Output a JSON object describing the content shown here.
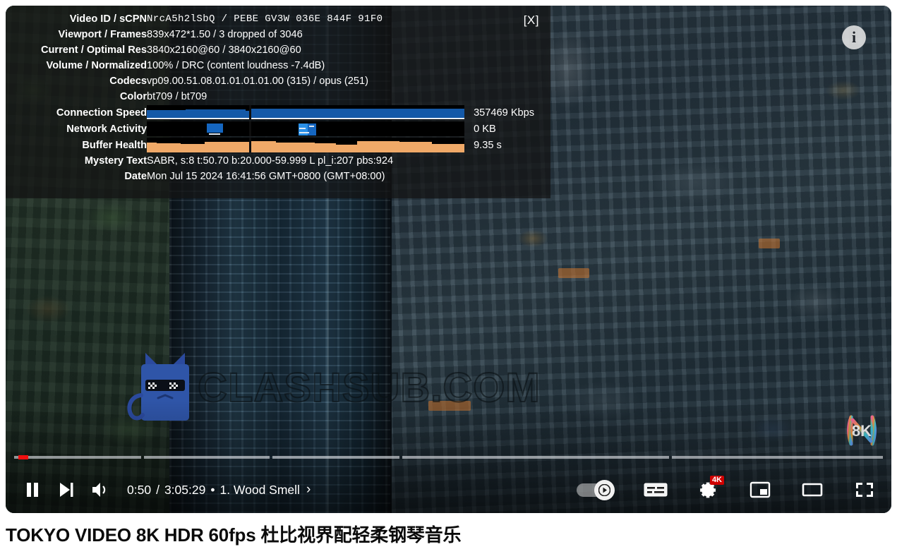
{
  "player": {
    "info_icon": "info-icon",
    "watermark_text": "CLASHSUB.COM",
    "quality_badge": "8K",
    "cat_logo": "cool-cat-logo"
  },
  "stats": {
    "close_label": "[X]",
    "rows": [
      {
        "key": "Video ID / sCPN",
        "value": "NrcA5h2lSbQ / PEBE GV3W 036E 844F 91F0",
        "mono": true
      },
      {
        "key": "Viewport / Frames",
        "value": "839x472*1.50 / 3 dropped of 3046",
        "mono": false
      },
      {
        "key": "Current / Optimal Res",
        "value": "3840x2160@60 / 3840x2160@60",
        "mono": false
      },
      {
        "key": "Volume / Normalized",
        "value": "100% / DRC (content loudness -7.4dB)",
        "mono": false
      },
      {
        "key": "Codecs",
        "value": "vp09.00.51.08.01.01.01.01.00 (315) / opus (251)",
        "mono": false
      },
      {
        "key": "Color",
        "value": "bt709 / bt709",
        "mono": false
      }
    ],
    "graphs": [
      {
        "key": "Connection Speed",
        "value": "357469 Kbps"
      },
      {
        "key": "Network Activity",
        "value": "0 KB"
      },
      {
        "key": "Buffer Health",
        "value": "9.35 s"
      }
    ],
    "mystery": {
      "key": "Mystery Text",
      "value": "SABR, s:8 t:50.70 b:20.000-59.999 L pl_i:207 pbs:924"
    },
    "date": {
      "key": "Date",
      "value": "Mon Jul 15 2024 16:41:56 GMT+0800 (GMT+08:00)"
    },
    "colors": {
      "connection_bar": "#1459a8",
      "network_block": "#1566c0",
      "buffer_fill": "#f0a968",
      "panel_bg": "rgba(20,20,20,.72)"
    }
  },
  "controls": {
    "play_pause": "pause-button",
    "next": "next-video-button",
    "volume": "volume-button",
    "time_current": "0:50",
    "time_separator": "/",
    "time_total": "3:05:29",
    "bullet": "•",
    "chapter_title": "1. Wood Smell",
    "chapter_arrow": "›",
    "autoplay": "autoplay-toggle",
    "autoplay_state": "on",
    "subtitles": "subtitles-button",
    "settings": "settings-button",
    "settings_badge": "4K",
    "miniplayer": "miniplayer-button",
    "theater": "theater-mode-button",
    "fullscreen": "fullscreen-button",
    "progress_played_percent": 1.1,
    "progress_color": "#f00f0f"
  },
  "title": "TOKYO VIDEO 8K HDR 60fps 杜比视界配轻柔钢琴音乐"
}
